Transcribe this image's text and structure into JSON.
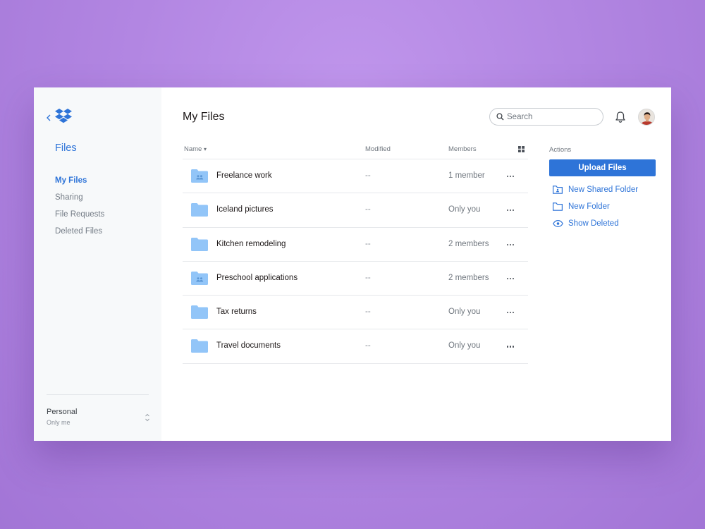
{
  "sidebar": {
    "title": "Files",
    "items": [
      {
        "label": "My Files",
        "active": true
      },
      {
        "label": "Sharing",
        "active": false
      },
      {
        "label": "File Requests",
        "active": false
      },
      {
        "label": "Deleted Files",
        "active": false
      }
    ],
    "account": {
      "name": "Personal",
      "subtitle": "Only me"
    }
  },
  "header": {
    "title": "My Files",
    "search_placeholder": "Search"
  },
  "table": {
    "columns": {
      "name": "Name",
      "modified": "Modified",
      "members": "Members"
    },
    "sort_indicator": "▾",
    "rows": [
      {
        "name": "Freelance work",
        "modified": "--",
        "members": "1 member",
        "shared": true
      },
      {
        "name": "Iceland pictures",
        "modified": "--",
        "members": "Only you",
        "shared": false
      },
      {
        "name": "Kitchen remodeling",
        "modified": "--",
        "members": "2 members",
        "shared": false
      },
      {
        "name": "Preschool applications",
        "modified": "--",
        "members": "2 members",
        "shared": true
      },
      {
        "name": "Tax returns",
        "modified": "--",
        "members": "Only you",
        "shared": false
      },
      {
        "name": "Travel documents",
        "modified": "--",
        "members": "Only you",
        "shared": false
      }
    ]
  },
  "actions": {
    "label": "Actions",
    "upload_label": "Upload Files",
    "links": [
      {
        "label": "New Shared Folder",
        "icon": "shared-folder-icon"
      },
      {
        "label": "New Folder",
        "icon": "folder-icon"
      },
      {
        "label": "Show Deleted",
        "icon": "eye-icon"
      }
    ]
  },
  "colors": {
    "accent": "#2e74d8",
    "folder": "#92c5f8",
    "background": "#b98ae6"
  }
}
